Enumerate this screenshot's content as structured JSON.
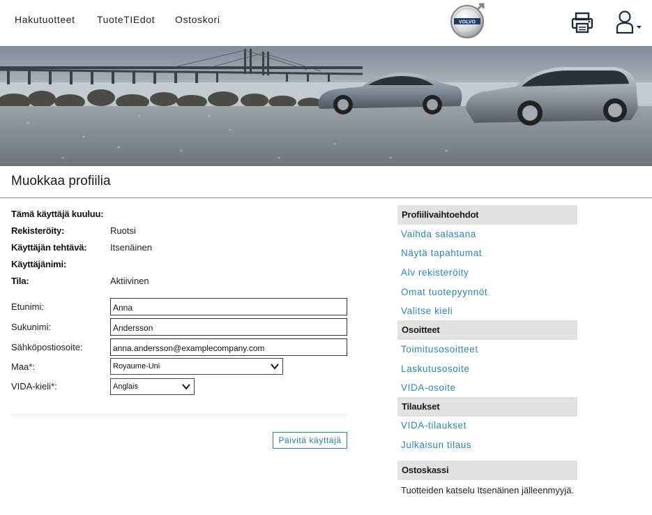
{
  "nav": {
    "items": [
      "Hakutuotteet",
      "TuoteTIEdot",
      "Ostoskori"
    ],
    "logo_text": "VOLVO"
  },
  "page": {
    "title": "Muokkaa profiilia"
  },
  "info": [
    {
      "label": "Tämä käyttäjä kuuluu:",
      "value": ""
    },
    {
      "label": "Rekisteröity:",
      "value": "Ruotsi"
    },
    {
      "label": "Käyttäjän tehtävä:",
      "value": "Itsenäinen"
    },
    {
      "label": "Käyttäjänimi:",
      "value": ""
    },
    {
      "label": "Tila:",
      "value": "Aktiivinen"
    }
  ],
  "form": {
    "first_name": {
      "label": "Etunimi:",
      "value": "Anna"
    },
    "last_name": {
      "label": "Sukunimi:",
      "value": "Andersson"
    },
    "email": {
      "label": "Sähköpostiosoite:",
      "value": "anna.andersson@examplecompany.com"
    },
    "country": {
      "label": "Maa*:",
      "value": "Royaume-Uni"
    },
    "vida_language": {
      "label": "VIDA-kieli*:",
      "value": "Anglais"
    },
    "update_button": "Päivitä käyttäjä"
  },
  "sidebar": {
    "profile_options": {
      "heading": "Profiilivaihtoehdot",
      "links": [
        "Vaihda salasana",
        "Näytä tapahtumat",
        "Alv rekisteröity",
        "Omat tuotepyynnöt",
        "Valitse kieli"
      ]
    },
    "addresses": {
      "heading": "Osoitteet",
      "links": [
        "Toimitusosoitteet",
        "Laskutusosoite",
        "VIDA-osoite"
      ]
    },
    "orders": {
      "heading": "Tilaukset",
      "links": [
        "VIDA-tilaukset",
        "Julkaisun tilaus"
      ]
    },
    "cart": {
      "heading": "Ostoskassi",
      "text": "Tuotteiden katselu Itsenäinen jälleenmyyjä."
    }
  },
  "colors": {
    "link": "#2e86b8",
    "button_border": "#2a7fa8",
    "sidebar_heading_bg": "#e2e2e2"
  },
  "icons": [
    "volvo-logo",
    "printer-icon",
    "user-icon",
    "chevron-down-icon"
  ]
}
